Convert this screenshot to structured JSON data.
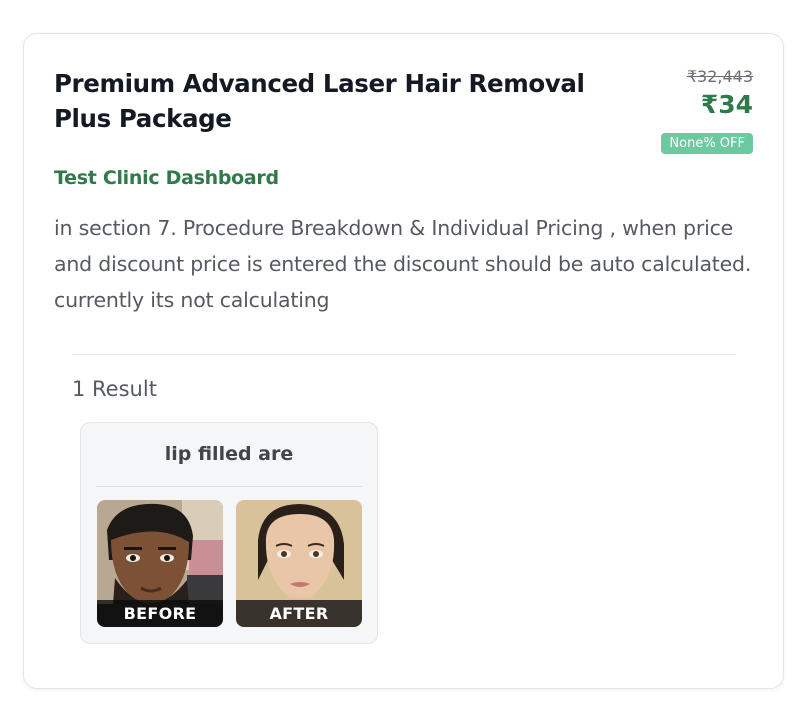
{
  "package": {
    "title": "Premium Advanced Laser Hair Removal Plus Package",
    "original_price": "₹32,443",
    "current_price": "₹34",
    "discount_badge": "None% OFF",
    "clinic_name": "Test Clinic Dashboard",
    "description": "in section 7. Procedure Breakdown & Individual Pricing , when price and discount price is entered the discount should be auto calculated. currently its not calculating"
  },
  "results": {
    "count_label": "1 Result",
    "items": [
      {
        "title": "lip filled are",
        "before_label": "BEFORE",
        "after_label": "AFTER"
      }
    ]
  },
  "colors": {
    "accent_green": "#2f7a4a",
    "badge_green": "#6cc9a0",
    "title_text": "#141a24",
    "body_text": "#555a62"
  }
}
